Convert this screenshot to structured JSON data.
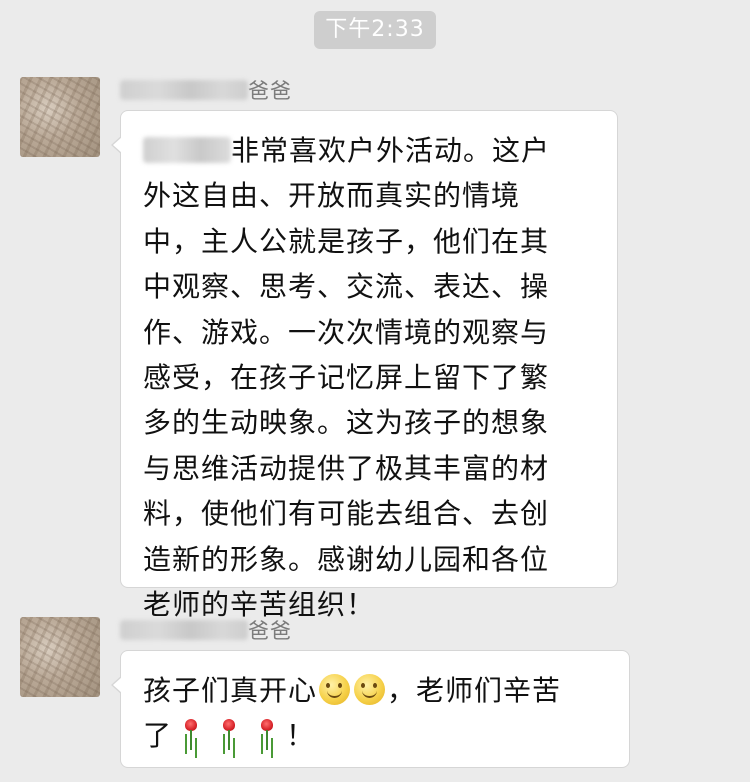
{
  "timestamp": "下午2:33",
  "messages": [
    {
      "sender_suffix": "爸爸",
      "lines": [
        "非常喜欢户外活动。这户",
        "外这自由、开放而真实的情境",
        "中，主人公就是孩子，他们在其",
        "中观察、思考、交流、表达、操",
        "作、游戏。一次次情境的观察与",
        "感受，在孩子记忆屏上留下了繁",
        "多的生动映象。这为孩子的想象",
        "与思维活动提供了极其丰富的材",
        "料，使他们有可能去组合、去创",
        "造新的形象。感谢幼儿园和各位",
        "老师的辛苦组织！"
      ]
    },
    {
      "sender_suffix": "爸爸",
      "line1_before": "孩子们真开心",
      "line1_after": "，老师们辛苦",
      "line2_before": "了",
      "line2_after": "！",
      "emoji": [
        "smile-emoji",
        "rose-emoji"
      ]
    }
  ]
}
